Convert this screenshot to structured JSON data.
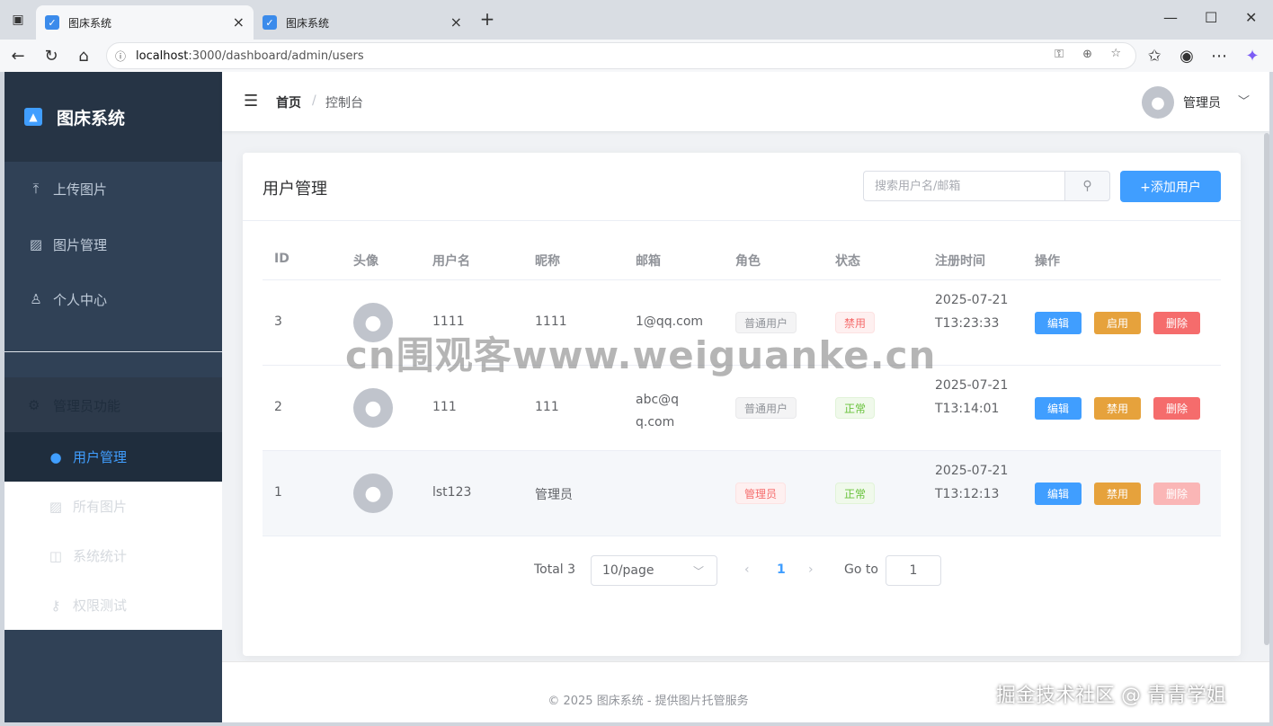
{
  "browser": {
    "tabs": [
      {
        "title": "图床系统",
        "active": true
      },
      {
        "title": "图床系统",
        "active": false
      }
    ],
    "url_host": "localhost",
    "url_rest": ":3000/dashboard/admin/users"
  },
  "sidebar": {
    "logo_text": "图床系统",
    "items": [
      {
        "label": "上传图片",
        "icon": "upload-icon"
      },
      {
        "label": "图片管理",
        "icon": "image-icon"
      },
      {
        "label": "个人中心",
        "icon": "user-icon"
      }
    ],
    "admin_group": {
      "label": "管理员功能",
      "icon": "gear-icon"
    },
    "sub_items": [
      {
        "label": "用户管理",
        "icon": "user-icon",
        "active": true
      },
      {
        "label": "所有图片",
        "icon": "picture-icon"
      },
      {
        "label": "系统统计",
        "icon": "chart-icon"
      },
      {
        "label": "权限测试",
        "icon": "key-icon"
      }
    ]
  },
  "header": {
    "breadcrumb_home": "首页",
    "breadcrumb_sep": "/",
    "breadcrumb_current": "控制台",
    "user_name": "管理员"
  },
  "card": {
    "title": "用户管理",
    "search_placeholder": "搜索用户名/邮箱",
    "add_button": "+添加用户"
  },
  "table": {
    "columns": [
      "ID",
      "头像",
      "用户名",
      "昵称",
      "邮箱",
      "角色",
      "状态",
      "注册时间",
      "操作"
    ],
    "rows": [
      {
        "id": "3",
        "username": "1111",
        "nickname": "1111",
        "email": "1@qq.com",
        "role": "普通用户",
        "status": "禁用",
        "time": "2025-07-21T13:23:33",
        "edit": "编辑",
        "toggle": "启用",
        "delete": "删除"
      },
      {
        "id": "2",
        "username": "111",
        "nickname": "111",
        "email": "abc@qq.com",
        "role": "普通用户",
        "status": "正常",
        "time": "2025-07-21T13:14:01",
        "edit": "编辑",
        "toggle": "禁用",
        "delete": "删除"
      },
      {
        "id": "1",
        "username": "lst123",
        "nickname": "管理员",
        "email": "",
        "role": "管理员",
        "status": "正常",
        "time": "2025-07-21T13:12:13",
        "edit": "编辑",
        "toggle": "禁用",
        "delete": "删除"
      }
    ]
  },
  "pagination": {
    "total_text": "Total 3",
    "page_size": "10/page",
    "current_page": "1",
    "goto_label": "Go to",
    "goto_value": "1"
  },
  "footer": {
    "text": "© 2025 图床系统 - 提供图片托管服务"
  },
  "watermarks": {
    "center": "cn围观客www.weiguanke.cn",
    "corner": "掘金技术社区 @ 青青学姐"
  },
  "colors": {
    "primary": "#409eff",
    "sidebar_bg": "#304156",
    "warning": "#e6a23c",
    "danger": "#f56c6c",
    "success": "#67c23a"
  }
}
